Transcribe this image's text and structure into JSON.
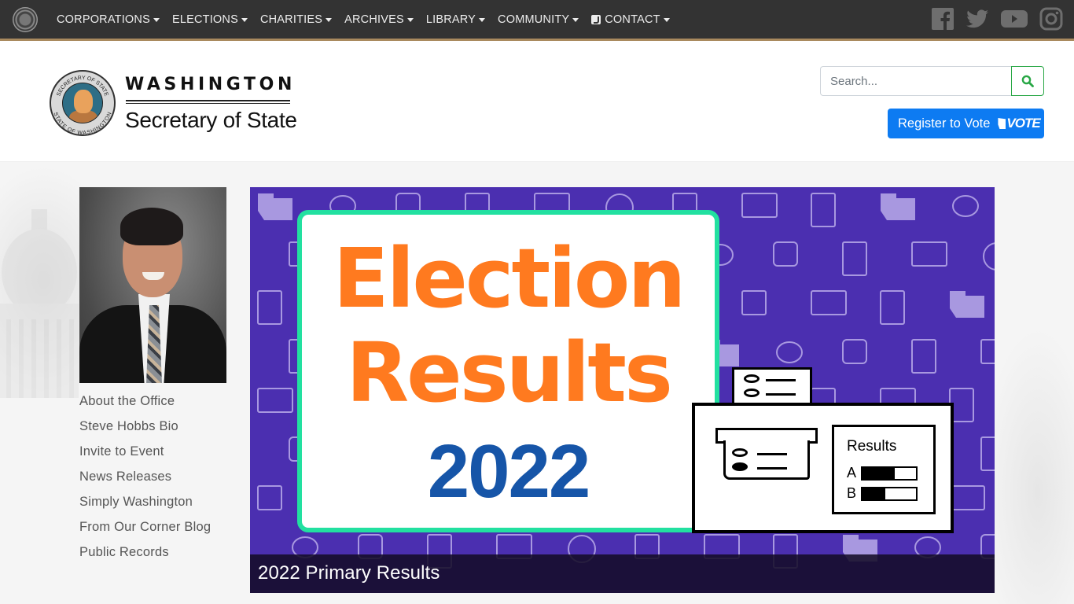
{
  "topnav": {
    "menu": [
      {
        "label": "CORPORATIONS",
        "icon": null
      },
      {
        "label": "ELECTIONS",
        "icon": null
      },
      {
        "label": "CHARITIES",
        "icon": null
      },
      {
        "label": "ARCHIVES",
        "icon": null
      },
      {
        "label": "LIBRARY",
        "icon": null
      },
      {
        "label": "COMMUNITY",
        "icon": null
      },
      {
        "label": "CONTACT",
        "icon": "phone-icon"
      }
    ],
    "social": [
      "facebook-icon",
      "twitter-icon",
      "youtube-icon",
      "instagram-icon"
    ],
    "colors": {
      "bar": "#333333",
      "accent_border": "#a98a5e"
    }
  },
  "header": {
    "logo_title": "WASHINGTON",
    "logo_subtitle": "Secretary of State",
    "seal_text_top": "SECRETARY OF STATE",
    "seal_text_bottom": "STATE OF WASHINGTON",
    "search": {
      "placeholder": "Search...",
      "value": ""
    },
    "register_button": {
      "label": "Register to Vote",
      "badge": "VOTE",
      "color": "#0d7bf2"
    }
  },
  "sidebar": {
    "photo_alt": "Steve Hobbs portrait",
    "links": [
      "About the Office",
      "Steve Hobbs Bio",
      "Invite to Event",
      "News Releases",
      "Simply Washington",
      "From Our Corner Blog",
      "Public Records"
    ]
  },
  "carousel": {
    "slide": {
      "headline_line1": "Election",
      "headline_line2": "Results",
      "year": "2022",
      "results_title": "Results",
      "results": [
        {
          "label": "A",
          "fraction": 0.6
        },
        {
          "label": "B",
          "fraction": 0.42
        }
      ],
      "caption": "2022 Primary Results"
    },
    "colors": {
      "background": "#4b2fb0",
      "card_border": "#22e0a0",
      "headline": "#ff7a1f",
      "year": "#1655a8"
    }
  }
}
